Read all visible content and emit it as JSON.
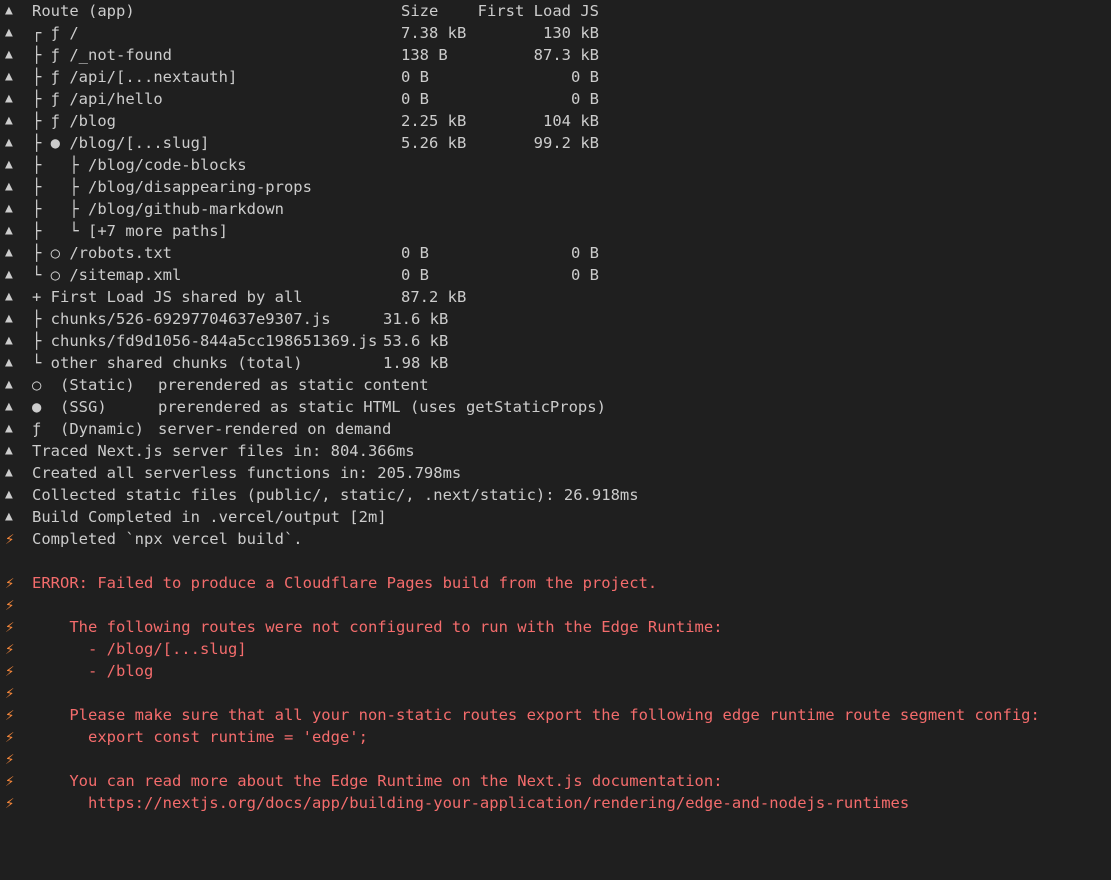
{
  "header": {
    "route": "Route (app)",
    "size": "Size",
    "first_load": "First Load JS"
  },
  "routes": [
    {
      "text": "┌ ƒ /",
      "size": "7.38 kB",
      "first": "130 kB"
    },
    {
      "text": "├ ƒ /_not-found",
      "size": "138 B",
      "first": "87.3 kB"
    },
    {
      "text": "├ ƒ /api/[...nextauth]",
      "size": "0 B",
      "first": "0 B"
    },
    {
      "text": "├ ƒ /api/hello",
      "size": "0 B",
      "first": "0 B"
    },
    {
      "text": "├ ƒ /blog",
      "size": "2.25 kB",
      "first": "104 kB"
    },
    {
      "text": "├ ● /blog/[...slug]",
      "size": "5.26 kB",
      "first": "99.2 kB"
    },
    {
      "text": "├   ├ /blog/code-blocks",
      "size": "",
      "first": ""
    },
    {
      "text": "├   ├ /blog/disappearing-props",
      "size": "",
      "first": ""
    },
    {
      "text": "├   ├ /blog/github-markdown",
      "size": "",
      "first": ""
    },
    {
      "text": "├   └ [+7 more paths]",
      "size": "",
      "first": ""
    },
    {
      "text": "├ ○ /robots.txt",
      "size": "0 B",
      "first": "0 B"
    },
    {
      "text": "└ ○ /sitemap.xml",
      "size": "0 B",
      "first": "0 B"
    }
  ],
  "shared": {
    "title": "+ First Load JS shared by all",
    "title_size": "87.2 kB",
    "chunks": [
      {
        "text": "├ chunks/526-69297704637e9307.js",
        "size": "31.6 kB"
      },
      {
        "text": "├ chunks/fd9d1056-844a5cc198651369.js",
        "size": "53.6 kB"
      },
      {
        "text": "└ other shared chunks (total)",
        "size": "1.98 kB"
      }
    ]
  },
  "legend": [
    {
      "symbol": "○  (Static)",
      "desc": "prerendered as static content"
    },
    {
      "symbol": "●  (SSG)",
      "desc": "prerendered as static HTML (uses getStaticProps)"
    },
    {
      "symbol": "ƒ  (Dynamic)",
      "desc": "server-rendered on demand"
    }
  ],
  "build_log": [
    "Traced Next.js server files in: 804.366ms",
    "Created all serverless functions in: 205.798ms",
    "Collected static files (public/, static/, .next/static): 26.918ms",
    "Build Completed in .vercel/output [2m]"
  ],
  "completed": "Completed `npx vercel build`.",
  "error": {
    "title": "ERROR: Failed to produce a Cloudflare Pages build from the project.",
    "intro": "    The following routes were not configured to run with the Edge Runtime:",
    "routes": [
      "      - /blog/[...slug]",
      "      - /blog"
    ],
    "hint": "    Please make sure that all your non-static routes export the following edge runtime route segment config:",
    "code": "      export const runtime = 'edge';",
    "more": "    You can read more about the Edge Runtime on the Next.js documentation:",
    "link": "      https://nextjs.org/docs/app/building-your-application/rendering/edge-and-nodejs-runtimes"
  },
  "icons": {
    "triangle": "▲",
    "bolt": "⚡"
  },
  "colors": {
    "background": "#1f1f1f",
    "text": "#cccccc",
    "error": "#f46c6c",
    "bolt": "#f4863a"
  }
}
